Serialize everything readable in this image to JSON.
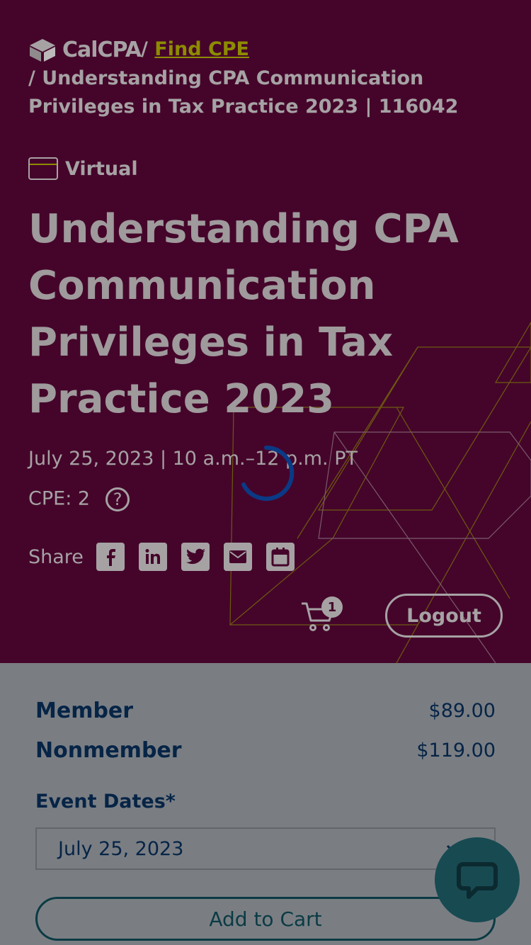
{
  "breadcrumb": {
    "logo_text": "CalCPA",
    "separator": "/",
    "link": "Find CPE",
    "current": "/ Understanding CPA Communication Privileges in Tax Practice 2023 | 116042"
  },
  "event": {
    "mode": "Virtual",
    "title": "Understanding CPA Communication Privileges in Tax Practice 2023",
    "datetime": "July 25, 2023 | 10 a.m.–12 p.m. PT",
    "cpe": "CPE: 2",
    "help_symbol": "?"
  },
  "share": {
    "label": "Share",
    "icons": [
      "facebook-icon",
      "linkedin-icon",
      "twitter-icon",
      "email-icon",
      "calendar-icon"
    ]
  },
  "header_actions": {
    "cart_count": "1",
    "logout_label": "Logout"
  },
  "pricing": {
    "rows": [
      {
        "name": "Member",
        "price": "$89.00"
      },
      {
        "name": "Nonmember",
        "price": "$119.00"
      }
    ]
  },
  "form": {
    "dates_label": "Event Dates*",
    "selected_date": "July 25, 2023",
    "add_label": "Add to Cart"
  },
  "colors": {
    "hero_bg": "#45052a",
    "overlay_gray": "#7a7e83",
    "navy": "#062446",
    "accent_olive": "#8d8c00",
    "chat_teal": "#184a52"
  }
}
